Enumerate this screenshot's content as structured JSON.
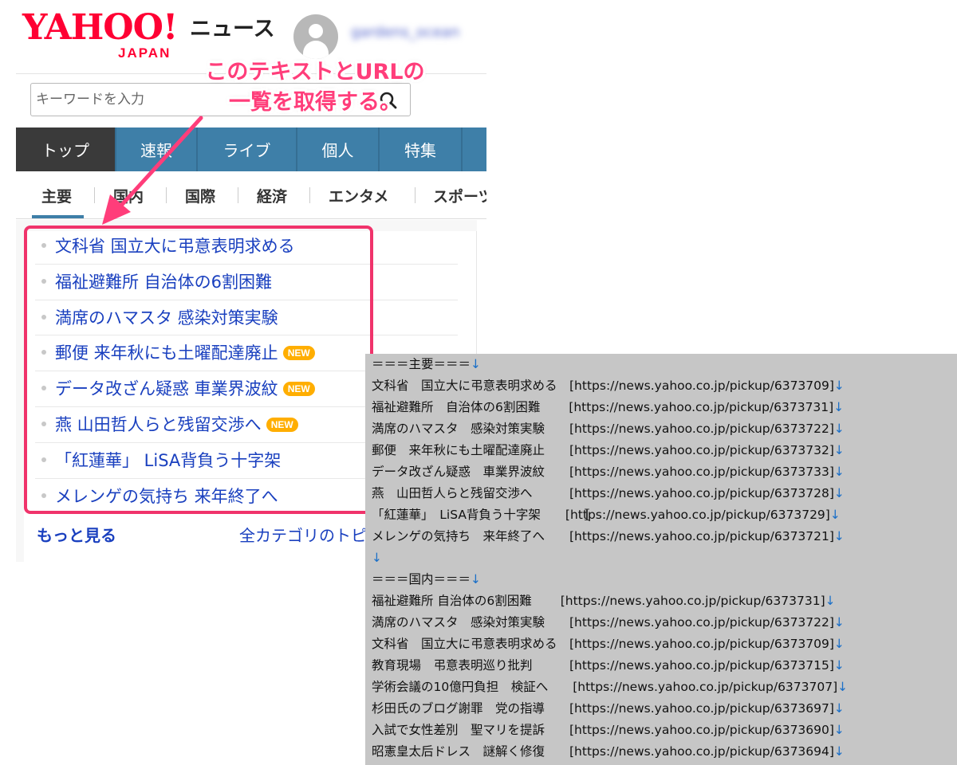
{
  "header": {
    "logo_main": "YAHOO!",
    "logo_sub": "JAPAN",
    "service_name": "ニュース",
    "username": "gardens_ocean"
  },
  "search": {
    "placeholder": "キーワードを入力",
    "icon": "search-icon"
  },
  "main_nav": {
    "tabs": [
      {
        "label": "トップ",
        "active": true
      },
      {
        "label": "速報",
        "active": false
      },
      {
        "label": "ライブ",
        "active": false
      },
      {
        "label": "個人",
        "active": false
      },
      {
        "label": "特集",
        "active": false
      }
    ]
  },
  "category_nav": {
    "items": [
      "主要",
      "国内",
      "国際",
      "経済",
      "エンタメ",
      "スポーツ"
    ],
    "active": "主要"
  },
  "news": {
    "items": [
      {
        "title": "文科省 国立大に弔意表明求める",
        "is_new": false
      },
      {
        "title": "福祉避難所 自治体の6割困難",
        "is_new": false
      },
      {
        "title": "満席のハマスタ 感染対策実験",
        "is_new": false
      },
      {
        "title": "郵便 来年秋にも土曜配達廃止",
        "is_new": true
      },
      {
        "title": "データ改ざん疑惑 車業界波紋",
        "is_new": true
      },
      {
        "title": "燕 山田哲人らと残留交渉へ",
        "is_new": true
      },
      {
        "title": "「紅蓮華」 LiSA背負う十字架",
        "is_new": false
      },
      {
        "title": "メレンゲの気持ち 来年終了へ",
        "is_new": false
      }
    ],
    "new_badge": "NEW",
    "more_link": "もっと見る",
    "all_categories_link": "全カテゴリのトピ"
  },
  "annotation": {
    "line1": "このテキストとURLの",
    "line2": "一覧を取得する。",
    "color": "#ff3d7a"
  },
  "output": {
    "lines": [
      {
        "text": "＝＝＝主要＝＝＝",
        "lf": "↓"
      },
      {
        "text": "文科省　国立大に弔意表明求める　[https://news.yahoo.co.jp/pickup/6373709]",
        "lf": "↓"
      },
      {
        "text": "福祉避難所　自治体の6割困難　　 [https://news.yahoo.co.jp/pickup/6373731]",
        "lf": "↓"
      },
      {
        "text": "満席のハマスタ　感染対策実験　　[https://news.yahoo.co.jp/pickup/6373722]",
        "lf": "↓"
      },
      {
        "text": "郵便　来年秋にも土曜配達廃止　　[https://news.yahoo.co.jp/pickup/6373732]",
        "lf": "↓"
      },
      {
        "text": "データ改ざん疑惑　車業界波紋　　[https://news.yahoo.co.jp/pickup/6373733]",
        "lf": "↓"
      },
      {
        "text": "燕　山田哲人らと残留交渉へ　　　[https://news.yahoo.co.jp/pickup/6373728]",
        "lf": "↓"
      },
      {
        "text": "「紅蓮華」　LiSA背負う十字架　　[https://news.yahoo.co.jp/pickup/6373729]",
        "lf": "↓"
      },
      {
        "text": "メレンゲの気持ち　来年終了へ　　[https://news.yahoo.co.jp/pickup/6373721]",
        "lf": "↓"
      },
      {
        "text": "",
        "lf": "↓"
      },
      {
        "text": "＝＝＝国内＝＝＝",
        "lf": "↓"
      },
      {
        "text": "福祉避難所 自治体の6割困難　　 [https://news.yahoo.co.jp/pickup/6373731]",
        "lf": "↓"
      },
      {
        "text": "満席のハマスタ　感染対策実験　　[https://news.yahoo.co.jp/pickup/6373722]",
        "lf": "↓"
      },
      {
        "text": "文科省　国立大に弔意表明求める　[https://news.yahoo.co.jp/pickup/6373709]",
        "lf": "↓"
      },
      {
        "text": "教育現場　弔意表明巡り批判　　　[https://news.yahoo.co.jp/pickup/6373715]",
        "lf": "↓"
      },
      {
        "text": "学術会議の10億円負担　検証へ　　[https://news.yahoo.co.jp/pickup/6373707]",
        "lf": "↓"
      },
      {
        "text": "杉田氏のブログ謝罪　党の指導　　[https://news.yahoo.co.jp/pickup/6373697]",
        "lf": "↓"
      },
      {
        "text": "入試で女性差別　聖マリを提訴　　[https://news.yahoo.co.jp/pickup/6373690]",
        "lf": "↓"
      },
      {
        "text": "昭憲皇太后ドレス　謎解く修復　　[https://news.yahoo.co.jp/pickup/6373694]",
        "lf": "↓"
      }
    ],
    "cursor_glyph": "I"
  },
  "colors": {
    "brand_red": "#ff0033",
    "nav_blue": "#3e7fa8",
    "nav_active": "#3a3a3a",
    "link_blue": "#1a40bf",
    "highlight": "#f0336b",
    "new_badge": "#ffae00",
    "output_bg": "#c6c6c6"
  }
}
